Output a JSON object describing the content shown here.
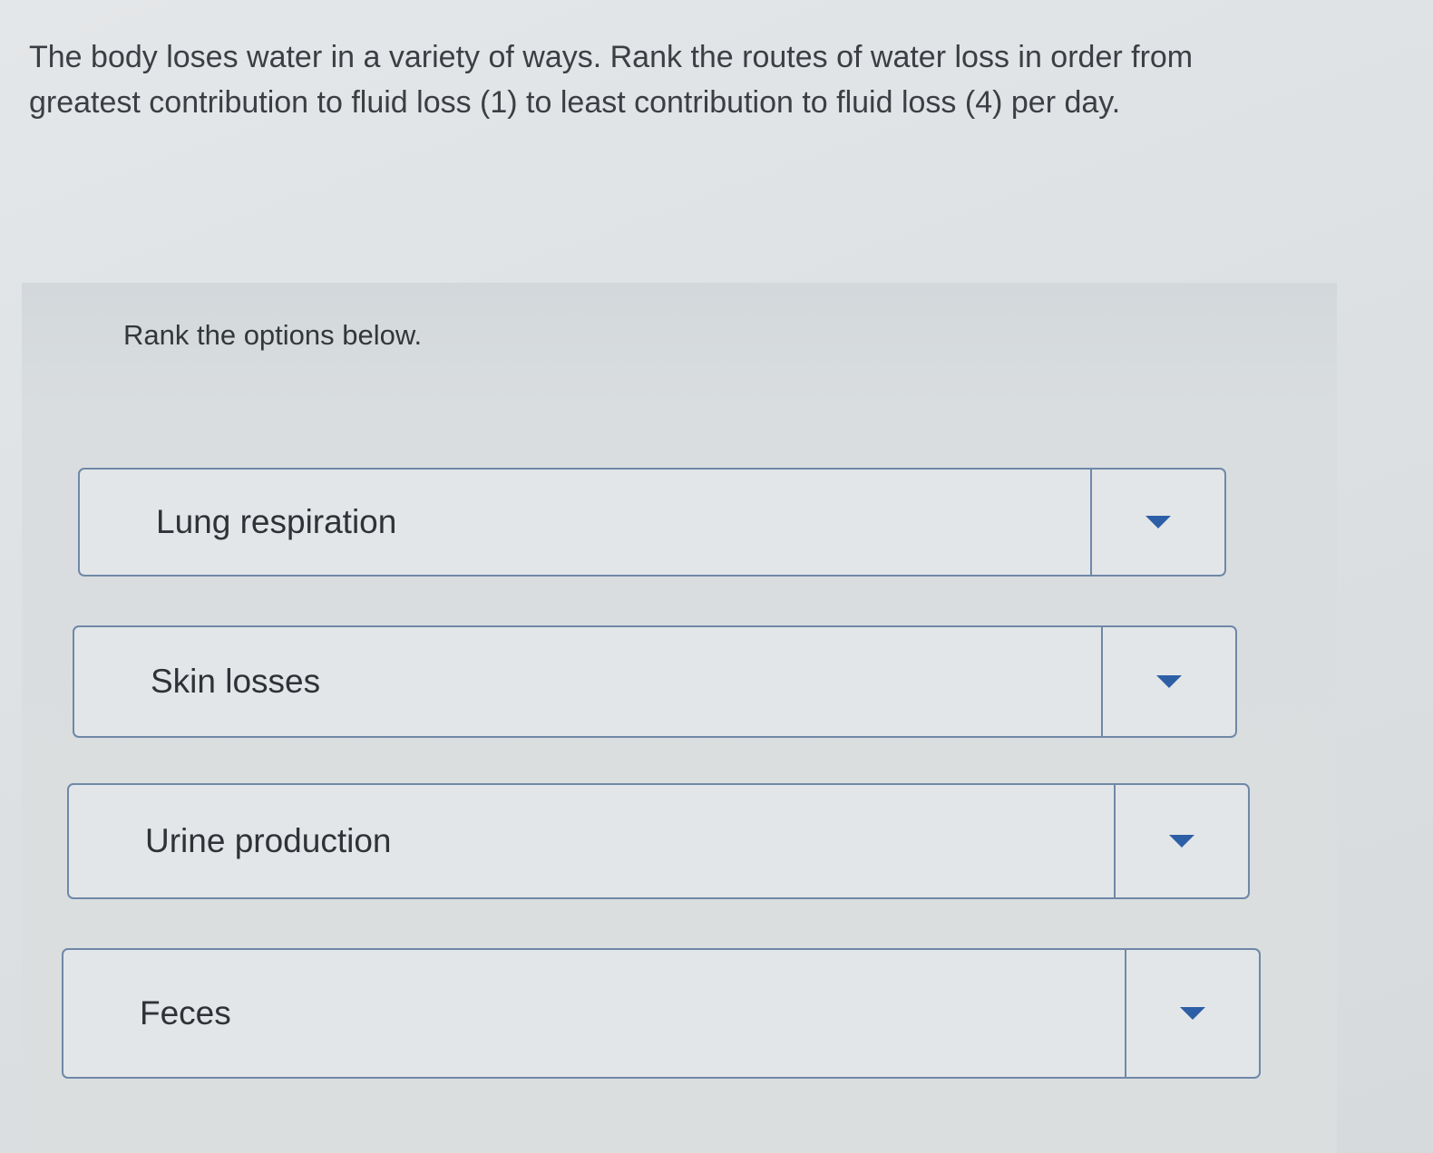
{
  "question": {
    "text": "The body loses water in a variety of ways. Rank the routes of water loss in order from greatest contribution to fluid loss (1) to least contribution to fluid loss (4) per day."
  },
  "ranking": {
    "instruction": "Rank the options below.",
    "options": [
      {
        "label": "Lung respiration",
        "icon": "caret-down-icon"
      },
      {
        "label": "Skin losses",
        "icon": "caret-down-icon"
      },
      {
        "label": "Urine production",
        "icon": "caret-down-icon"
      },
      {
        "label": "Feces",
        "icon": "caret-down-icon"
      }
    ]
  },
  "colors": {
    "border": "#6f88a8",
    "caret": "#2d5fa6",
    "text": "#3b3e42"
  }
}
